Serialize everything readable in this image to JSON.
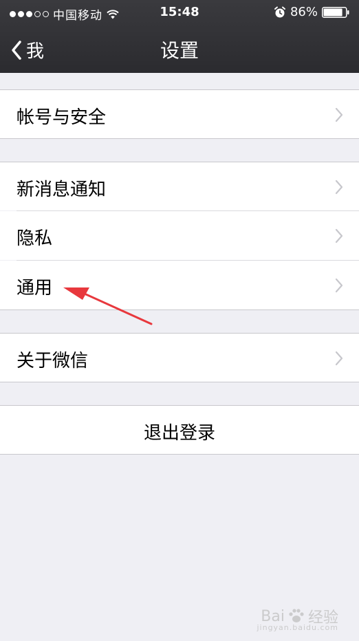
{
  "status_bar": {
    "carrier": "中国移动",
    "time": "15:48",
    "battery_percent": "86%",
    "battery_level": 0.86,
    "signal_bars_filled": 3,
    "signal_bars_total": 5
  },
  "nav": {
    "back_label": "我",
    "title": "设置"
  },
  "settings": {
    "account_security": "帐号与安全",
    "new_message_notifications": "新消息通知",
    "privacy": "隐私",
    "general": "通用",
    "about_wechat": "关于微信",
    "logout": "退出登录"
  },
  "icons": {
    "wifi": "wifi-icon",
    "alarm": "alarm-icon",
    "battery": "battery-icon",
    "back": "chevron-left-icon",
    "disclosure": "chevron-right-icon"
  },
  "colors": {
    "nav_bg": "#2f2f33",
    "page_bg": "#efeff4",
    "cell_bg": "#ffffff",
    "chevron": "#c7c7cc",
    "annotation_arrow": "#e8383d"
  },
  "watermark": {
    "brand": "Bai",
    "brand_tail": "经验",
    "url": "jingyan.baidu.com"
  }
}
